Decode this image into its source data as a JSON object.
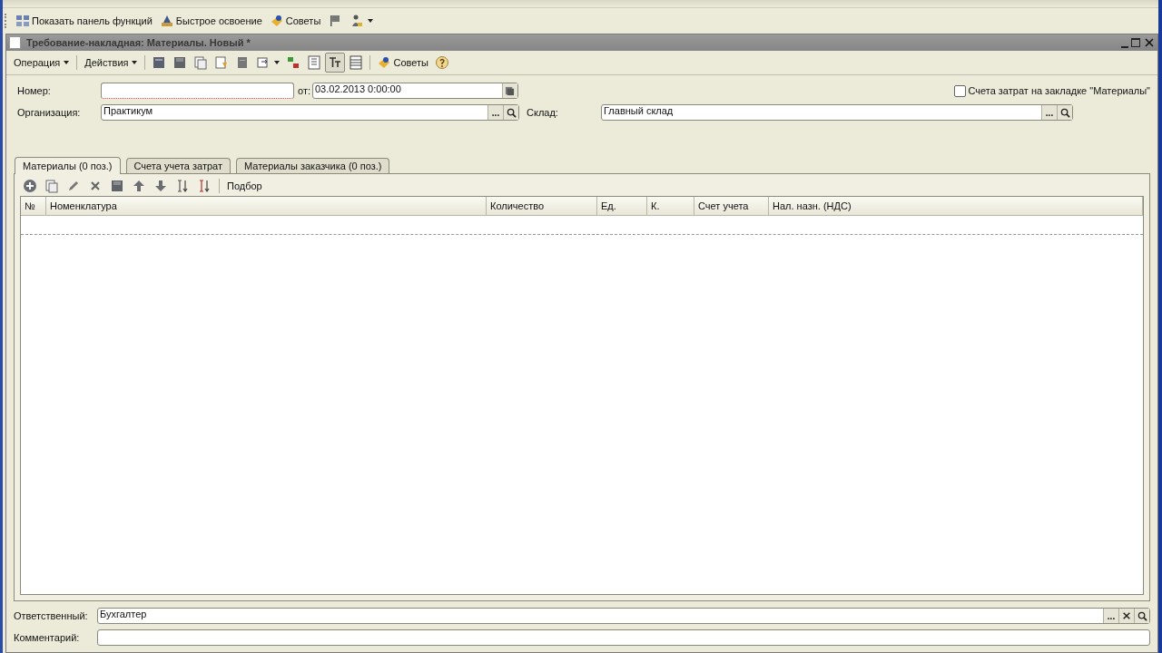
{
  "main_toolbar": {
    "items": [
      {
        "kind": "labeled",
        "label": "Показать панель функций"
      },
      {
        "kind": "labeled",
        "label": "Быстрое освоение"
      },
      {
        "kind": "labeled",
        "label": "Советы"
      },
      {
        "kind": "icon"
      },
      {
        "kind": "icon"
      }
    ]
  },
  "window": {
    "title": "Требование-накладная: Материалы. Новый *"
  },
  "doc_toolbar": {
    "items": [
      {
        "kind": "menu",
        "label": "Операция"
      },
      {
        "kind": "menu",
        "label": "Действия"
      },
      {
        "kind": "icon"
      },
      {
        "kind": "icon"
      },
      {
        "kind": "icon"
      },
      {
        "kind": "icon"
      },
      {
        "kind": "icon"
      },
      {
        "kind": "icon"
      },
      {
        "kind": "icon"
      },
      {
        "kind": "icon"
      },
      {
        "kind": "toggle",
        "on": true
      },
      {
        "kind": "icon"
      },
      {
        "kind": "labeled",
        "label": "Советы"
      },
      {
        "kind": "icon"
      }
    ]
  },
  "form": {
    "number": {
      "label": "Номер:",
      "required": true
    },
    "date": {
      "label": "от:",
      "value": "03.02.2013  0:00:00"
    },
    "cost_accounts_checkbox": {
      "label": "Счета затрат на закладке \"Материалы\"",
      "checked": false
    },
    "organization": {
      "label": "Организация:",
      "value": "Практикум",
      "select_button": "..."
    },
    "warehouse": {
      "label": "Склад:",
      "value": "Главный склад",
      "select_button": "..."
    }
  },
  "tabs": [
    {
      "label": "Материалы (0 поз.)",
      "selected": true
    },
    {
      "label": "Счета учета затрат",
      "selected": false
    },
    {
      "label": "Материалы заказчика (0 поз.)",
      "selected": false
    }
  ],
  "table_toolbar": {
    "pick_label": "Подбор"
  },
  "table": {
    "columns": [
      "№",
      "Номенклатура",
      "Количество",
      "Ед.",
      "К.",
      "Счет учета",
      "Нал. назн. (НДС)"
    ]
  },
  "footer": {
    "responsible": {
      "label": "Ответственный:",
      "value": "Бухгалтер",
      "select_button": "..."
    },
    "comment": {
      "label": "Комментарий:"
    }
  }
}
